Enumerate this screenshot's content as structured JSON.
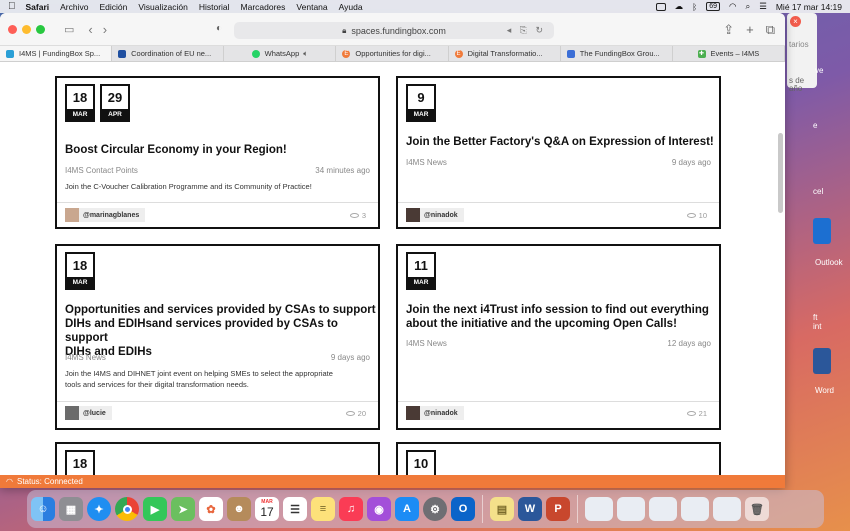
{
  "menubar": {
    "app": "Safari",
    "items": [
      "Archivo",
      "Edición",
      "Visualización",
      "Historial",
      "Marcadores",
      "Ventana",
      "Ayuda"
    ],
    "clock": "Mié 17 mar  14:19",
    "battery": "69"
  },
  "browser": {
    "url": "spaces.fundingbox.com",
    "tabs": [
      {
        "label": "I4MS | FundingBox Sp...",
        "active": true,
        "favicon_color": "#2a9fd6"
      },
      {
        "label": "Coordination of EU ne...",
        "active": false,
        "favicon_color": "#1f4fa0"
      },
      {
        "label": "WhatsApp",
        "active": false,
        "favicon_color": "#25d366",
        "speaker": true
      },
      {
        "label": "Opportunities for digi...",
        "active": false,
        "favicon_color": "#f07a3a"
      },
      {
        "label": "Digital Transformatio...",
        "active": false,
        "favicon_color": "#f07a3a"
      },
      {
        "label": "The FundingBox Grou...",
        "active": false,
        "favicon_color": "#3b6ed6"
      },
      {
        "label": "Events – I4MS",
        "active": false,
        "favicon_color": "#4caf50"
      }
    ]
  },
  "cards": [
    {
      "dates": [
        {
          "day": "18",
          "month": "MAR"
        },
        {
          "day": "29",
          "month": "APR"
        }
      ],
      "title_lines": [
        "Boost Circular Economy in your Region!"
      ],
      "source": "I4MS Contact Points",
      "time": "34 minutes ago",
      "desc_lines": [
        "Join the C-Voucher Calibration Programme and its Community of Practice!"
      ],
      "user": "@marinagblanes",
      "views": "3"
    },
    {
      "dates": [
        {
          "day": "9",
          "month": "MAR"
        }
      ],
      "title_lines": [
        "Join the Better Factory's Q&A on Expression of Interest!"
      ],
      "source": "I4MS News",
      "time": "9 days ago",
      "desc_lines": [],
      "user": "@ninadok",
      "views": "10"
    },
    {
      "dates": [
        {
          "day": "18",
          "month": "MAR"
        }
      ],
      "title_lines": [
        "Opportunities and services provided by CSAs to support",
        "DIHs and EDIHsand services provided by CSAs to support",
        "DIHs and EDIHs"
      ],
      "source": "I4MS News",
      "time": "9 days ago",
      "desc_lines": [
        "Join the I4MS and DIHNET joint event on helping SMEs to select the appropriate",
        "tools and services for their digital transformation needs."
      ],
      "user": "@lucie",
      "views": "20"
    },
    {
      "dates": [
        {
          "day": "11",
          "month": "MAR"
        }
      ],
      "title_lines": [
        "Join the next i4Trust info session to find out everything",
        "about the initiative and the upcoming Open Calls!"
      ],
      "source": "I4MS News",
      "time": "12 days ago",
      "desc_lines": [],
      "user": "@ninadok",
      "views": "21"
    },
    {
      "dates": [
        {
          "day": "18",
          "month": ""
        }
      ]
    },
    {
      "dates": [
        {
          "day": "10",
          "month": ""
        }
      ]
    }
  ],
  "status": "Status: Connected",
  "desktop_labels": [
    "tarios",
    "s de",
    "año",
    "ve",
    "e",
    "cel",
    "Outlook",
    "ft",
    "int",
    "Word"
  ],
  "dock": {
    "calendar_month": "MAR",
    "calendar_day": "17",
    "apps": [
      "finder-icon",
      "launchpad-icon",
      "safari-icon",
      "chrome-icon",
      "facetime-icon",
      "maps-icon",
      "photos-icon",
      "contacts-icon",
      "calendar-icon",
      "reminders-icon",
      "notes-icon",
      "music-icon",
      "podcasts-icon",
      "appstore-icon",
      "settings-icon",
      "outlook-icon",
      "stickies-icon",
      "word-icon",
      "powerpoint-icon",
      "trash-icon"
    ]
  }
}
